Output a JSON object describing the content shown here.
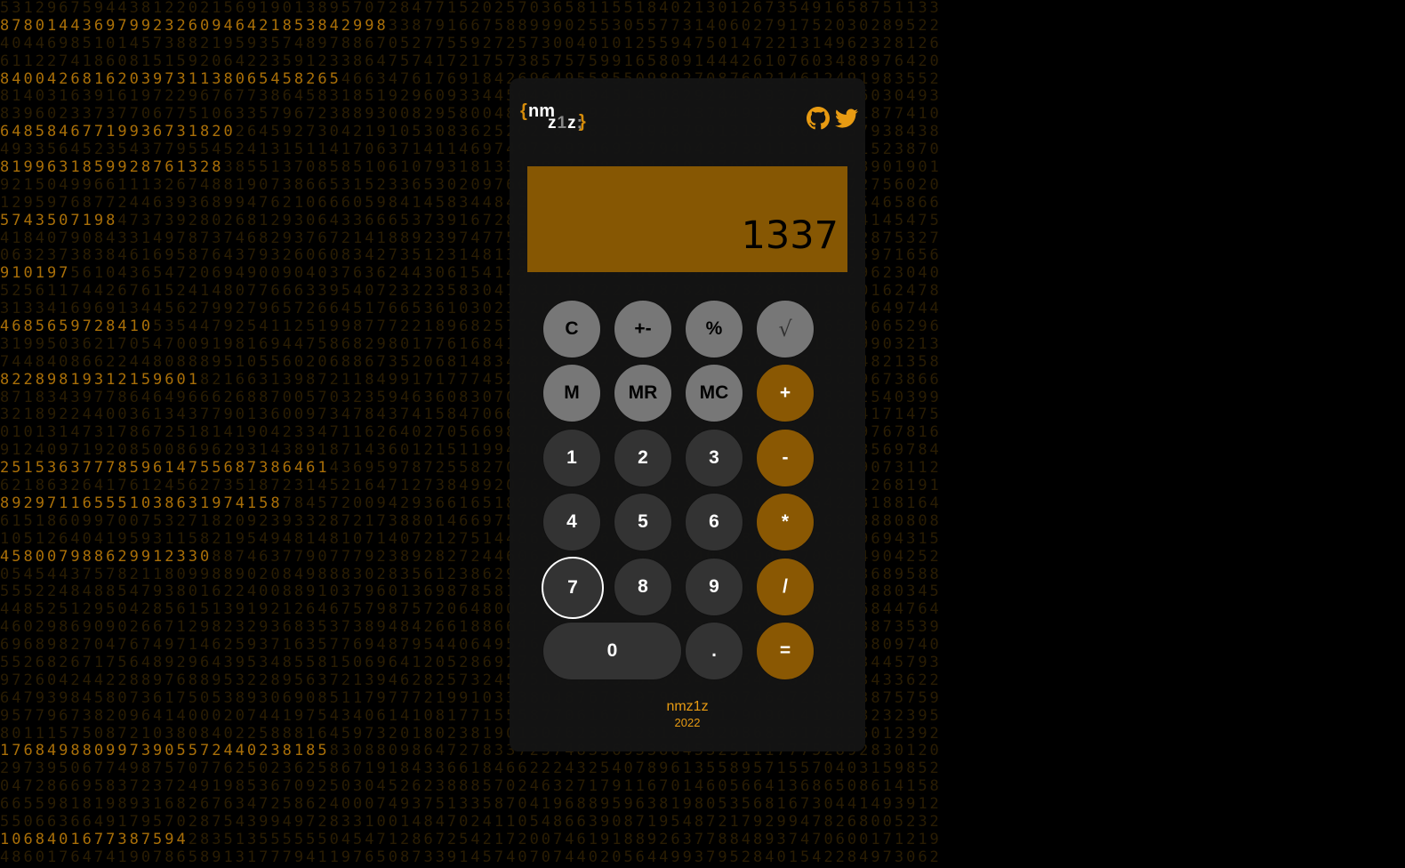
{
  "background": {
    "description_color": "#a96f08",
    "bright_rows": [
      "878014436979923260946421853842998",
      "8400426816203973113806545826 5",
      "648584677199367318 20",
      "81996318599287 61328",
      "57435071 98",
      "910197",
      "468565972 8410",
      "82289819312159601",
      "2515363777859614755687386461",
      "8929711655510386319 74158",
      "458007988629912330",
      "1768498809973905572440238185",
      "1068401677387594",
      "21779883632619852427378326914987"
    ]
  },
  "logo": {
    "brace_open": "{",
    "nm": "nm",
    "z1z_z1": "z",
    "z1z_one": "1",
    "z1z_z2": "z",
    "z1z_semicolon": ";",
    "brace_close": "}"
  },
  "social": {
    "github_icon": "github-icon",
    "twitter_icon": "twitter-icon",
    "accent": "#e89b12"
  },
  "display": {
    "value": "1337",
    "color": "#865703"
  },
  "keys": {
    "clear": "C",
    "plus_minus": "+-",
    "percent": "%",
    "sqrt": "√",
    "mem": "M",
    "mem_recall": "MR",
    "mem_clear": "MC",
    "add": "+",
    "subtract": "-",
    "multiply": "*",
    "divide": "/",
    "equals": "=",
    "one": "1",
    "two": "2",
    "three": "3",
    "four": "4",
    "five": "5",
    "six": "6",
    "seven": "7",
    "eight": "8",
    "nine": "9",
    "zero": "0",
    "decimal": "."
  },
  "footer": {
    "name": "nmz1z",
    "year": "2022"
  }
}
